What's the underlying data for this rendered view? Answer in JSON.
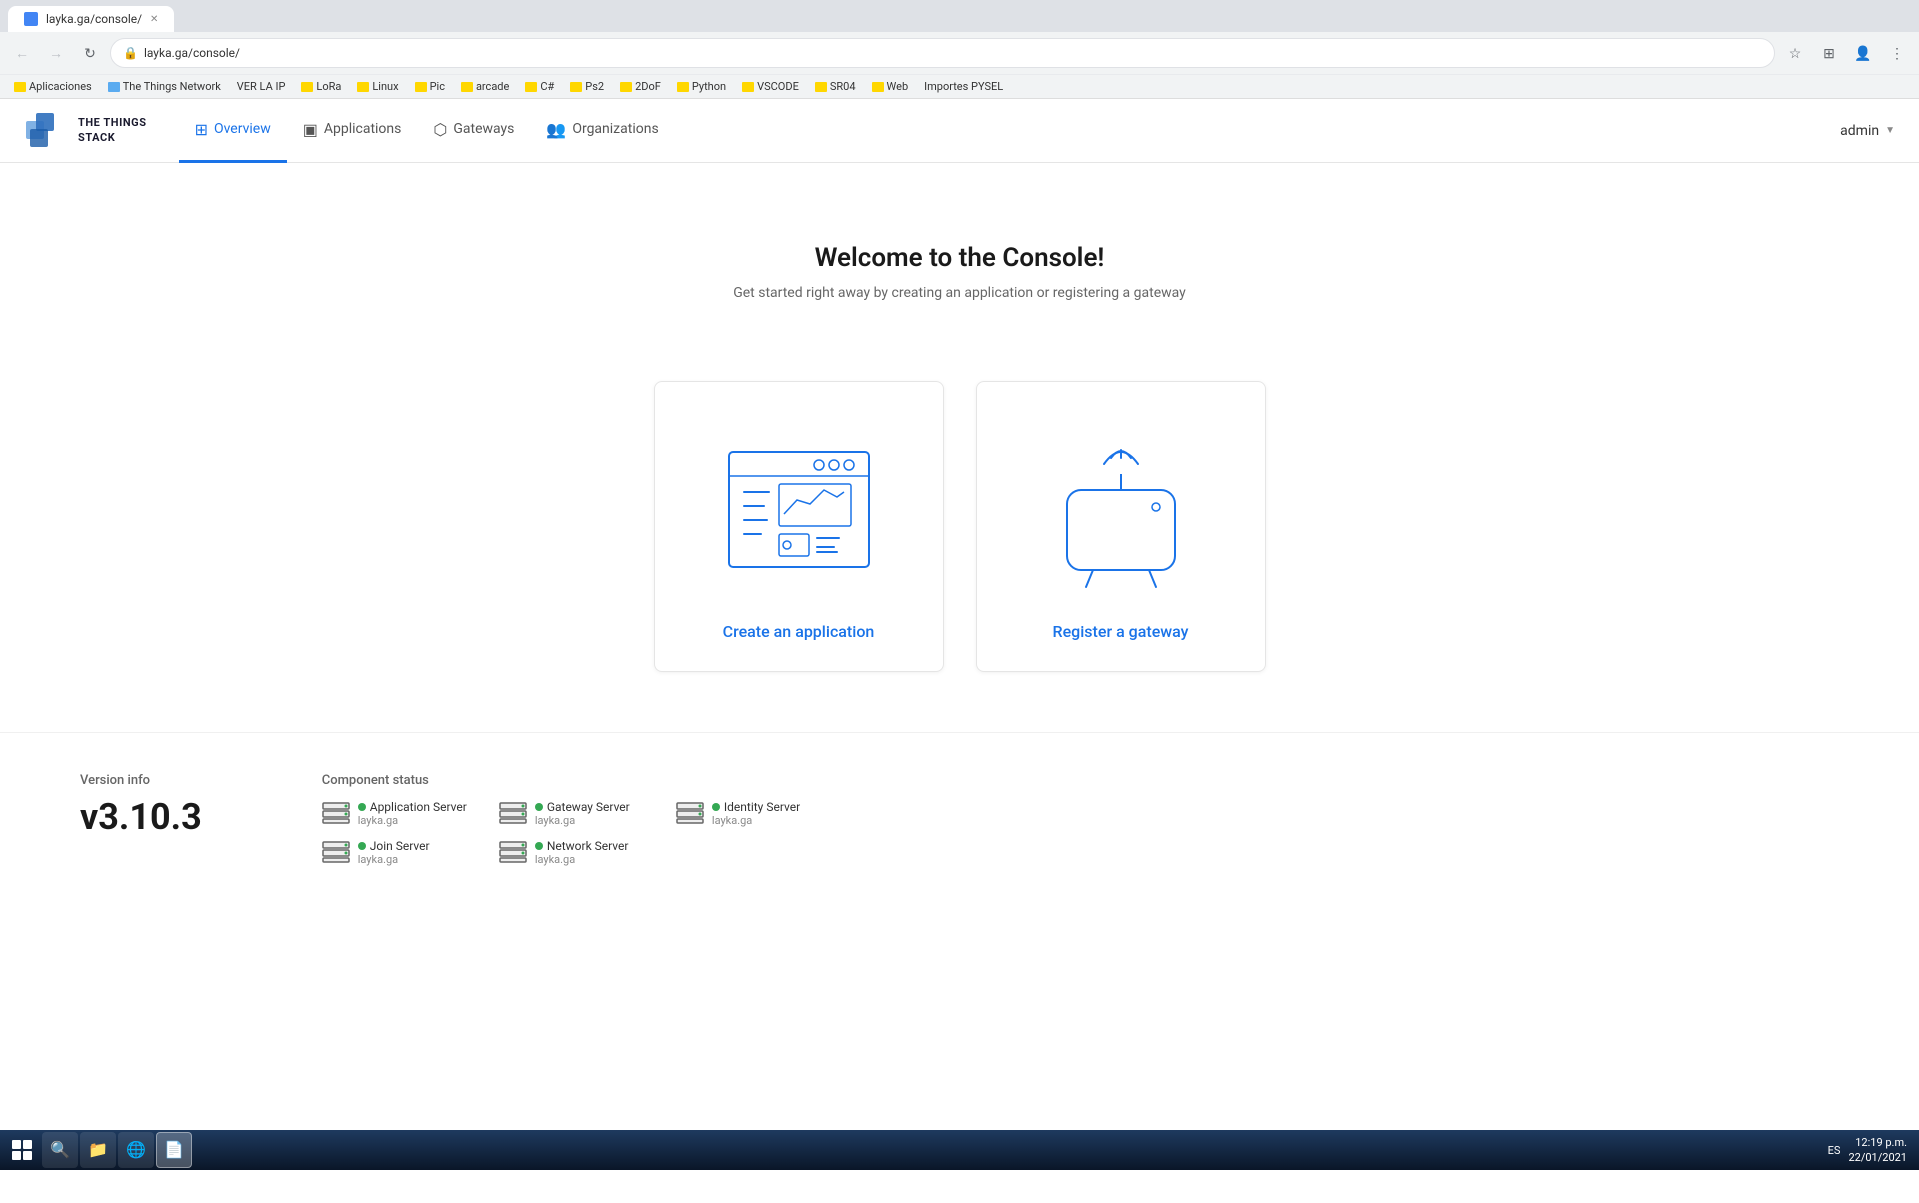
{
  "browser": {
    "tab_title": "layka.ga/console/",
    "url": "layka.ga/console/",
    "bookmarks": [
      {
        "label": "Aplicaciones",
        "type": "folder"
      },
      {
        "label": "The Things Network",
        "type": "link",
        "color": "blue"
      },
      {
        "label": "VER LA IP",
        "type": "link"
      },
      {
        "label": "LoRa",
        "type": "folder"
      },
      {
        "label": "Linux",
        "type": "folder"
      },
      {
        "label": "Pic",
        "type": "folder"
      },
      {
        "label": "arcade",
        "type": "folder"
      },
      {
        "label": "C#",
        "type": "folder"
      },
      {
        "label": "Ps2",
        "type": "folder"
      },
      {
        "label": "2DoF",
        "type": "folder"
      },
      {
        "label": "Python",
        "type": "folder"
      },
      {
        "label": "VSCODE",
        "type": "folder"
      },
      {
        "label": "SR04",
        "type": "folder"
      },
      {
        "label": "Web",
        "type": "folder"
      },
      {
        "label": "Importes PYSEL",
        "type": "link"
      }
    ]
  },
  "header": {
    "brand_line1": "THE THINGS",
    "brand_line2": "STACK",
    "nav": [
      {
        "id": "overview",
        "label": "Overview",
        "active": true
      },
      {
        "id": "applications",
        "label": "Applications",
        "active": false
      },
      {
        "id": "gateways",
        "label": "Gateways",
        "active": false
      },
      {
        "id": "organizations",
        "label": "Organizations",
        "active": false
      }
    ],
    "user_label": "admin"
  },
  "main": {
    "hero_title": "Welcome to the Console!",
    "hero_subtitle": "Get started right away by creating an application or registering a gateway",
    "cards": [
      {
        "id": "create-application",
        "label": "Create an application"
      },
      {
        "id": "register-gateway",
        "label": "Register a gateway"
      }
    ]
  },
  "footer": {
    "version_label": "Version info",
    "version_number": "v3.10.3",
    "component_status_label": "Component status",
    "components": [
      {
        "name": "Application Server",
        "host": "layka.ga",
        "status": "ok"
      },
      {
        "name": "Gateway Server",
        "host": "layka.ga",
        "status": "ok"
      },
      {
        "name": "Identity Server",
        "host": "layka.ga",
        "status": "ok"
      },
      {
        "name": "Join Server",
        "host": "layka.ga",
        "status": "ok"
      },
      {
        "name": "Network Server",
        "host": "layka.ga",
        "status": "ok"
      }
    ]
  },
  "taskbar": {
    "time": "12:19 p.m.",
    "date": "22/01/2021",
    "locale": "ES"
  }
}
